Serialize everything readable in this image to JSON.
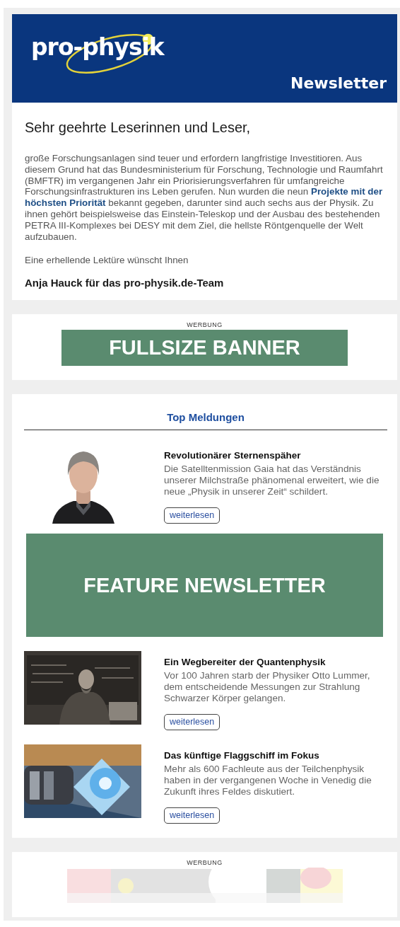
{
  "header": {
    "logo": "pro-physik",
    "title": "Newsletter"
  },
  "intro": {
    "greeting": "Sehr geehrte Leserinnen und Leser,",
    "paragraph": "große Forschungsanlagen sind teuer und erfordern langfristige Investitioren. Aus diesem Grund hat das Bundesministerium für Forschung, Technologie und Raumfahrt (BMFTR) im vergangenen Jahr ein Priorisierungsverfahren für umfangreiche Forschungsinfrastrukturen ins Leben gerufen. Nun wurden die neun **Projekte mit der höchsten Priorität** bekannt gegeben, darunter sind auch sechs aus der Physik. Zu ihnen gehört beispielsweise das Einstein-Teleskop und der Ausbau des bestehenden PETRA III-Komplexes bei DESY mit dem Ziel, die hellste Röntgenquelle der Welt aufzubauen.",
    "closing": "Eine erhellende Lektüre wünscht Ihnen",
    "signature": "Anja Hauck für das pro-physik.de-Team"
  },
  "top_ad": {
    "label": "WERBUNG",
    "kind": "banner",
    "text": "FULLSIZE BANNER"
  },
  "news": {
    "heading": "Top Meldungen",
    "items": [
      {
        "kind": "article",
        "title": "Revolutionärer Sternenspäher",
        "text": "Die Satelltenmission Gaia hat das Verständnis unserer Milchstraße phänomenal erweitert, wie die neue „Physik in unserer Zeit“ schildert.",
        "button": "weiterlesen"
      },
      {
        "kind": "feature",
        "text": "FEATURE NEWSLETTER"
      },
      {
        "kind": "article",
        "title": "Ein Wegbereiter der Quantenphysik",
        "text": "Vor 100 Jahren starb der Physiker Otto Lummer, dem entscheidende Messungen zur Strahlung Schwarzer Körper gelangen.",
        "button": "weiterlesen"
      },
      {
        "kind": "article",
        "title": "Das künftige Flaggschiff im Fokus",
        "text": "Mehr als 600 Fachleute aus der Teilchenphysik haben in der vergangenen Woche in Venedig die Zukunft ihres Feldes diskutiert.",
        "button": "weiterlesen"
      }
    ]
  },
  "bottom_ad": {
    "label": "WERBUNG",
    "kind": "picture"
  }
}
